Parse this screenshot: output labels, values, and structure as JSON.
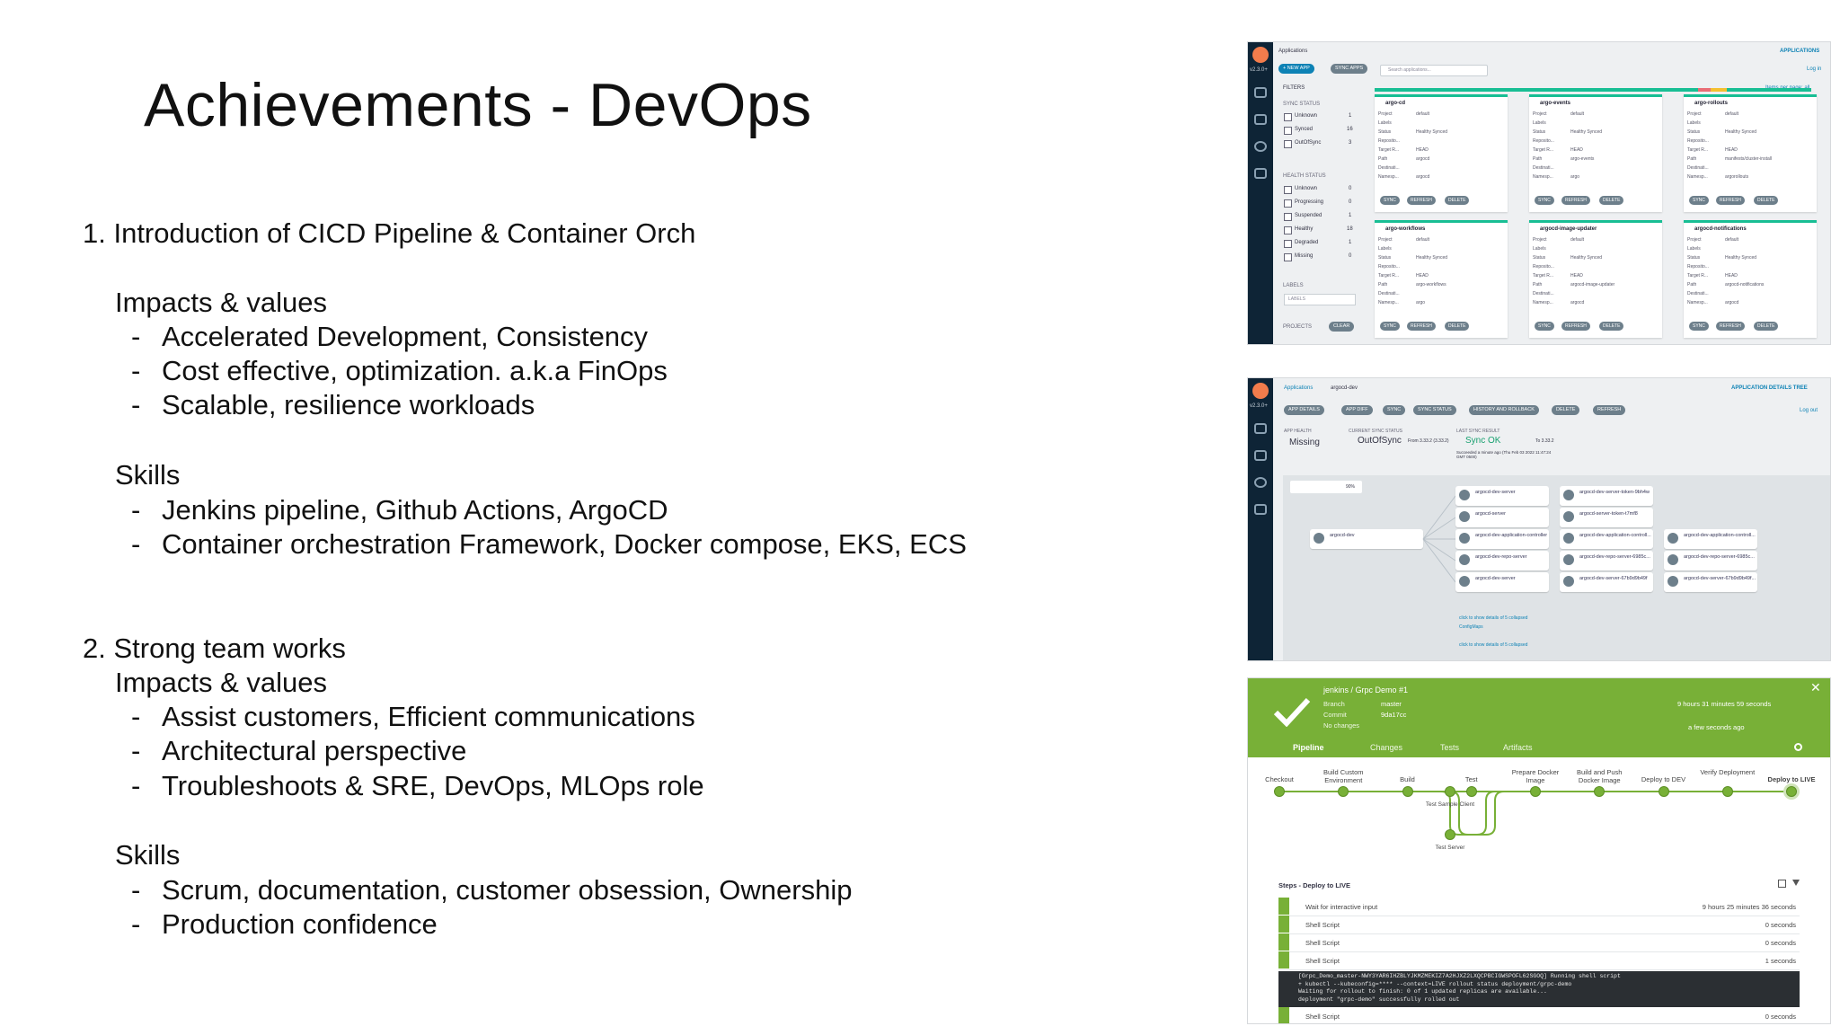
{
  "slide": {
    "title": "Achievements - DevOps",
    "section1": {
      "heading": "1.  Introduction of CICD Pipeline & Container Orch",
      "impacts_heading": "Impacts & values",
      "impacts": [
        "Accelerated Development, Consistency",
        "Cost effective, optimization. a.k.a FinOps",
        "Scalable, resilience workloads"
      ],
      "skills_heading": "Skills",
      "skills": [
        "Jenkins pipeline, Github Actions, ArgoCD",
        "Container orchestration Framework, Docker compose, EKS, ECS"
      ]
    },
    "section2": {
      "heading": "2. Strong team works",
      "impacts_heading": "Impacts & values",
      "impacts": [
        "Assist customers, Efficient communications",
        "Architectural perspective",
        "Troubleshoots & SRE, DevOps, MLOps role"
      ],
      "skills_heading": "Skills",
      "skills": [
        "Scrum, documentation, customer obsession, Ownership",
        "Production confidence"
      ]
    },
    "dash": "-"
  },
  "argo_apps": {
    "version": "v2.3.0+",
    "header_left": "Applications",
    "header_right": "APPLICATIONS",
    "new_app": "+ NEW APP",
    "sync_apps": "SYNC APPS",
    "search_placeholder": "Search applications...",
    "filters": "FILTERS",
    "items_per_page": "Items per page: all",
    "login": "Log in",
    "sync_status_title": "SYNC STATUS",
    "sync_status": [
      {
        "label": "Unknown",
        "count": "1"
      },
      {
        "label": "Synced",
        "count": "16"
      },
      {
        "label": "OutOfSync",
        "count": "3"
      }
    ],
    "health_status_title": "HEALTH STATUS",
    "health_status": [
      {
        "label": "Unknown",
        "count": "0"
      },
      {
        "label": "Progressing",
        "count": "0"
      },
      {
        "label": "Suspended",
        "count": "1"
      },
      {
        "label": "Healthy",
        "count": "18"
      },
      {
        "label": "Degraded",
        "count": "1"
      },
      {
        "label": "Missing",
        "count": "0"
      }
    ],
    "labels_title": "LABELS",
    "labels_placeholder": "LABELS",
    "projects_title": "PROJECTS",
    "clear": "CLEAR",
    "cards": [
      {
        "name": "argo-cd",
        "path": "argocd",
        "namespace": "argocd"
      },
      {
        "name": "argo-events",
        "path": "argo-events",
        "namespace": "argo"
      },
      {
        "name": "argo-rollouts",
        "path": "manifests/cluster-install",
        "namespace": "argorollouts"
      },
      {
        "name": "argo-workflows",
        "path": "argo-workflows",
        "namespace": "argo"
      },
      {
        "name": "argocd-image-updater",
        "path": "argocd-image-updater",
        "namespace": "argocd"
      },
      {
        "name": "argocd-notifications",
        "path": "argocd-notifications",
        "namespace": "argocd"
      }
    ],
    "card_keys": [
      "Project",
      "Labels",
      "Status",
      "Reposito...",
      "Target R...",
      "Path",
      "Destinati...",
      "Namesp..."
    ],
    "card_project": "default",
    "card_status": "Healthy  Synced",
    "card_target": "HEAD",
    "buttons": [
      "SYNC",
      "REFRESH",
      "DELETE"
    ]
  },
  "argo_tree": {
    "breadcrumb_root": "Applications",
    "breadcrumb_app": "argocd-dev",
    "header_right": "APPLICATION DETAILS TREE",
    "buttons": [
      "APP DETAILS",
      "APP DIFF",
      "SYNC",
      "SYNC STATUS",
      "HISTORY AND ROLLBACK",
      "DELETE",
      "REFRESH"
    ],
    "login": "Log out",
    "app_health_title": "APP HEALTH",
    "app_health": "Missing",
    "sync_status_title": "CURRENT SYNC STATUS",
    "sync_status": "OutOfSync",
    "sync_from": "From 3.33.2 (3.33.2)",
    "last_sync_title": "LAST SYNC RESULT",
    "last_sync": "Sync OK",
    "last_sync_to": "To 3.33.2",
    "last_sync_time": "Succeeded a minute ago (Thu Feb 03 2022 11:47:24 GMT 0500)",
    "zoom": "90%",
    "root_node": "argocd-dev",
    "col1": [
      "argocd-dev-server",
      "argocd-server",
      "argocd-dev-application-controller",
      "argocd-dev-repo-server",
      "argocd-dev-server"
    ],
    "col2": [
      "argocd-dev-server-token-9bh4w",
      "argocd-server-token-t7mf8",
      "argocd-dev-application-controll...",
      "argocd-dev-repo-server-6985c...",
      "argocd-dev-server-67b9d9b49f"
    ],
    "col3": [
      "argocd-dev-application-controll...",
      "argocd-dev-repo-server-6985c...",
      "argocd-dev-server-67b9d9b49f..."
    ],
    "collapsed1": "click to show details of 5 collapsed",
    "collapsed1_type": "ConfigMaps",
    "collapsed2": "click to show details of 5 collapsed"
  },
  "jenkins": {
    "title": "jenkins / Grpc Demo #1",
    "branch_label": "Branch",
    "branch": "master",
    "commit_label": "Commit",
    "commit": "9da17cc",
    "changes": "No changes",
    "duration": "9 hours 31 minutes 59 seconds",
    "ago": "a few seconds ago",
    "close": "✕",
    "tabs": [
      "Pipeline",
      "Changes",
      "Tests",
      "Artifacts"
    ],
    "stages": [
      "Checkout",
      "Build Custom Environment",
      "Build",
      "Test",
      "Prepare Docker Image",
      "Build and Push Docker Image",
      "Deploy to DEV",
      "Verify Deployment",
      "Deploy to LIVE"
    ],
    "parallel": [
      "Test Sample Client",
      "Test Server"
    ],
    "steps_title": "Steps - Deploy to LIVE",
    "steps": [
      {
        "label": "Wait for interactive input",
        "time": "9 hours 25 minutes 36 seconds"
      },
      {
        "label": "Shell Script",
        "time": "0 seconds"
      },
      {
        "label": "Shell Script",
        "time": "0 seconds"
      },
      {
        "label": "Shell Script",
        "time": "1 seconds"
      }
    ],
    "console": [
      "[Grpc_Demo_master-NWY3YAR6IHZBLYJKMZMEKIZ7A2HJXZ2LXQCPBCIGWSPOFL62SGOQ] Running shell script",
      "+ kubectl --kubeconfig=**** --context=LIVE rollout status deployment/grpc-demo",
      "Waiting for rollout to finish: 0 of 1 updated replicas are available...",
      "deployment \"grpc-demo\" successfully rolled out"
    ],
    "last_step": {
      "label": "Shell Script",
      "time": "0 seconds"
    }
  }
}
